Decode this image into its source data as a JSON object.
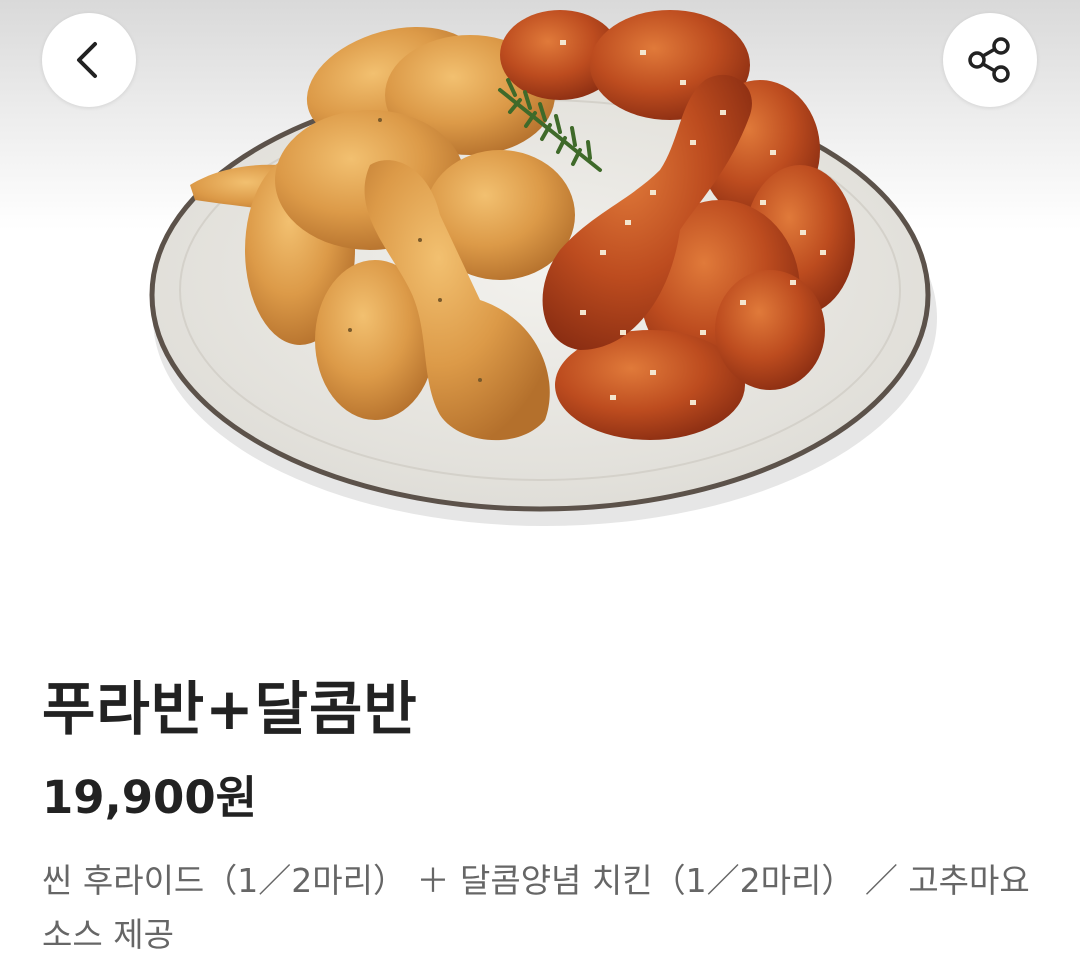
{
  "header": {
    "back_icon": "chevron-left-icon",
    "share_icon": "share-icon"
  },
  "product": {
    "image_subject": "fried-chicken-plate-photo",
    "name": "푸라반+달콤반",
    "price": "19,900원",
    "description": "씬 후라이드（1／2마리） ＋ 달콤양념 치킨（1／2마리） ／ 고추마요 소스 제공"
  },
  "colors": {
    "fried_chicken": "#d99a4a",
    "sauced_chicken": "#b8481f",
    "plate": "#ecebe6",
    "plate_rim": "#6b5f55",
    "text_primary": "#222222",
    "text_secondary": "#666666"
  }
}
